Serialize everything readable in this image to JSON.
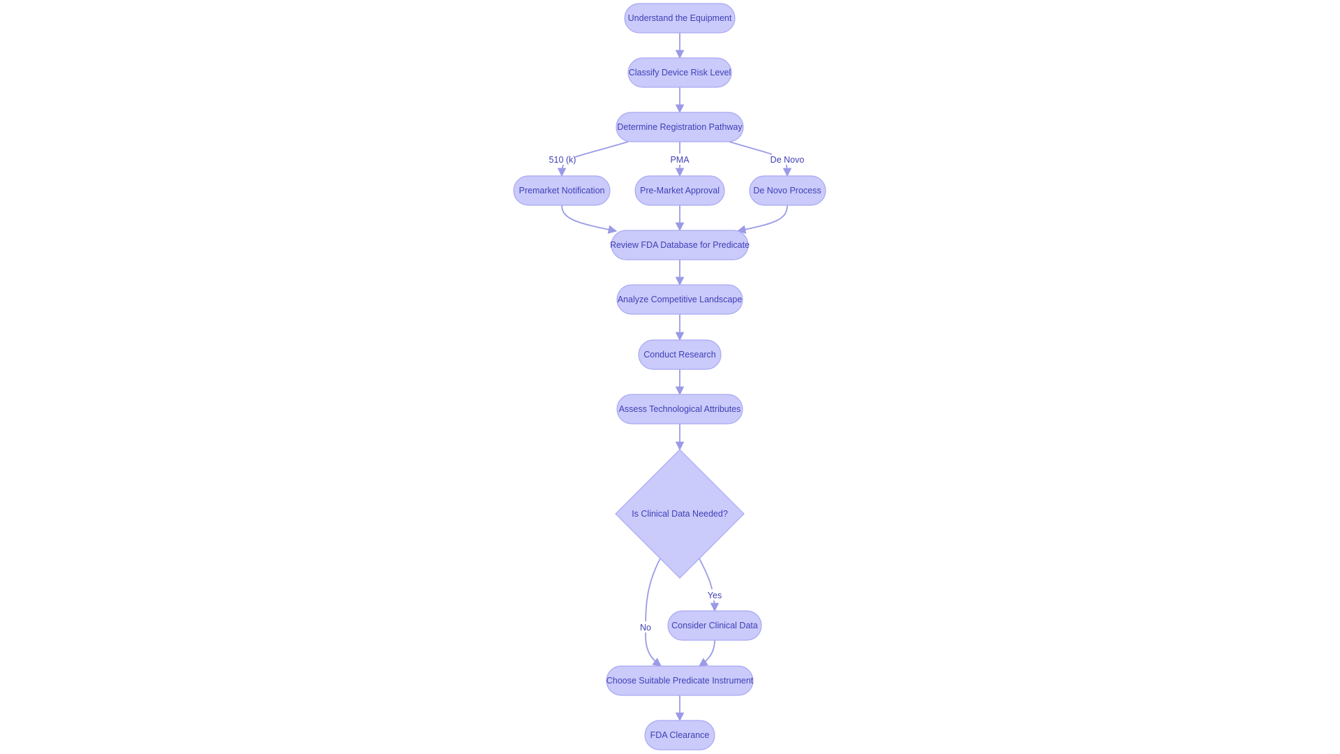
{
  "colors": {
    "node_fill": "#cacafb",
    "node_stroke": "#a9a9f2",
    "text": "#3f3fb5",
    "edge": "#9a9ae6"
  },
  "nodes": {
    "understand": "Understand the Equipment",
    "classify": "Classify Device Risk Level",
    "determine": "Determine Registration Pathway",
    "premarket": "Premarket Notification",
    "pma": "Pre-Market Approval",
    "denovo": "De Novo Process",
    "review": "Review FDA Database for Predicate",
    "analyze": "Analyze Competitive Landscape",
    "conduct": "Conduct Research",
    "assess": "Assess Technological Attributes",
    "decision": "Is Clinical Data Needed?",
    "consider": "Consider Clinical Data",
    "choose": "Choose Suitable Predicate Instrument",
    "clearance": "FDA Clearance"
  },
  "edge_labels": {
    "k510": "510 (k)",
    "pma": "PMA",
    "denovo": "De Novo",
    "yes": "Yes",
    "no": "No"
  }
}
